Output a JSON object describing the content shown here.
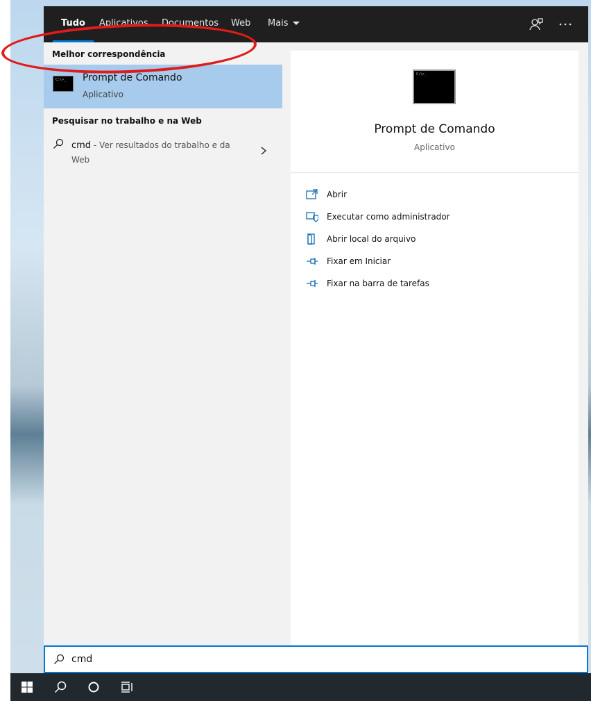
{
  "tabs": [
    {
      "label": "Tudo",
      "active": true
    },
    {
      "label": "Aplicativos"
    },
    {
      "label": "Documentos"
    },
    {
      "label": "Web"
    },
    {
      "label": "Mais"
    }
  ],
  "toolbar_icons": [
    "feedback-icon",
    "more-options-icon"
  ],
  "best_match": {
    "header": "Melhor correspondência",
    "title": "Prompt de Comando",
    "subtitle": "Aplicativo",
    "icon_text": "C:\\>_"
  },
  "web_section": {
    "header": "Pesquisar no trabalho e na Web",
    "query": "cmd",
    "suffix": " - Ver resultados do trabalho e da Web"
  },
  "preview": {
    "title": "Prompt de Comando",
    "subtitle": "Aplicativo",
    "actions": [
      {
        "label": "Abrir",
        "icon": "open-icon"
      },
      {
        "label": "Executar como administrador",
        "icon": "run-as-admin-icon"
      },
      {
        "label": "Abrir local do arquivo",
        "icon": "file-location-icon"
      },
      {
        "label": "Fixar em Iniciar",
        "icon": "pin-icon"
      },
      {
        "label": "Fixar na barra de tarefas",
        "icon": "pin-icon"
      }
    ]
  },
  "search": {
    "value": "cmd"
  },
  "colors": {
    "accent": "#0078d4",
    "highlight": "#a7cbec",
    "annotation": "#e01b1b",
    "tabbar": "#1f1f1f",
    "taskbar": "#22292e"
  }
}
